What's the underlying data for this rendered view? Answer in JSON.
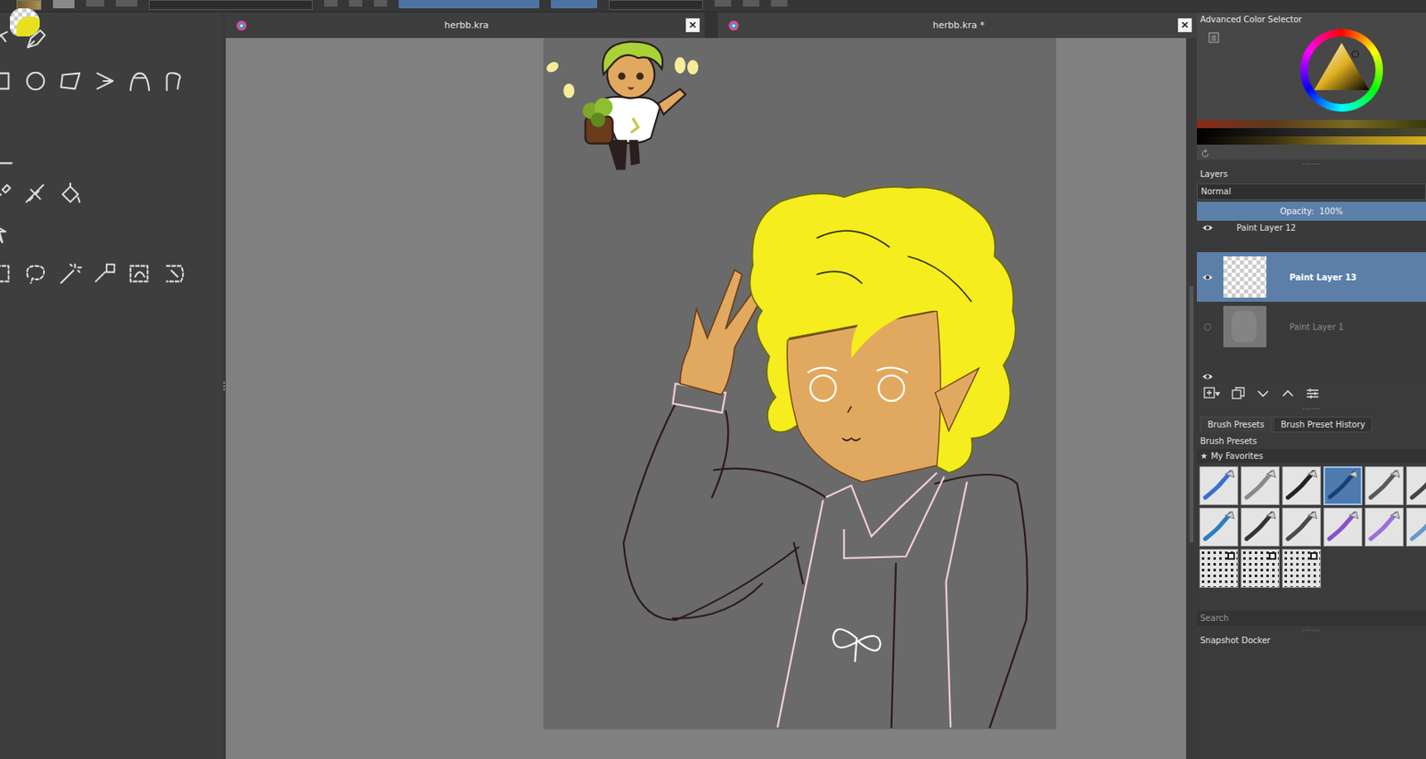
{
  "document_tabs": [
    {
      "label": "herbb.kra",
      "selected": false,
      "close": "×"
    },
    {
      "label": "herbb.kra *",
      "selected": true,
      "close": "×"
    }
  ],
  "color_selector": {
    "title": "Advanced Color Selector"
  },
  "layers": {
    "title": "Layers",
    "blend_mode": "Normal",
    "opacity": "Opacity:  100%",
    "opacity_level": 1,
    "items": [
      {
        "name": "Paint Layer 12",
        "visible": true,
        "selected": false,
        "kind": "blob",
        "color": "#e8a25a"
      },
      {
        "name": "Paint Layer 13",
        "visible": true,
        "selected": true,
        "kind": "empty",
        "color": "#ffffff"
      },
      {
        "name": "Paint Layer 1",
        "visible": false,
        "selected": false,
        "kind": "sketch",
        "color": "#8a8a8a"
      },
      {
        "name": "",
        "visible": true,
        "selected": false,
        "kind": "blob",
        "color": "#e6e01e"
      }
    ]
  },
  "brush_presets": {
    "tabs": [
      {
        "label": "Brush Presets",
        "selected": true
      },
      {
        "label": "Brush Preset History",
        "selected": false
      }
    ],
    "title": "Brush Presets",
    "tag_icon": "★",
    "tag": "My Favorites",
    "presets": [
      {
        "kind": "stroke",
        "selected": false,
        "color": "#3a6fd0"
      },
      {
        "kind": "stroke",
        "selected": false,
        "color": "#8a8a8a"
      },
      {
        "kind": "stroke",
        "selected": false,
        "color": "#222222"
      },
      {
        "kind": "stroke",
        "selected": true,
        "color": "#1c3f73"
      },
      {
        "kind": "stroke",
        "selected": false,
        "color": "#5a5a5a"
      },
      {
        "kind": "stroke",
        "selected": false,
        "color": "#444444"
      },
      {
        "kind": "stroke",
        "selected": false,
        "color": "#2a7fc0"
      },
      {
        "kind": "stroke",
        "selected": false,
        "color": "#333333"
      },
      {
        "kind": "stroke",
        "selected": false,
        "color": "#4a4a4a"
      },
      {
        "kind": "stroke",
        "selected": false,
        "color": "#8a4fd0"
      },
      {
        "kind": "stroke",
        "selected": false,
        "color": "#9a6fe0"
      },
      {
        "kind": "stroke",
        "selected": false,
        "color": "#6699cc"
      },
      {
        "kind": "halftone",
        "selected": false,
        "color": "#222222"
      },
      {
        "kind": "halftone",
        "selected": false,
        "color": "#222222"
      },
      {
        "kind": "halftone",
        "selected": false,
        "color": "#333333"
      }
    ],
    "search_placeholder": "Search"
  },
  "snapshot": {
    "title": "Snapshot Docker"
  }
}
